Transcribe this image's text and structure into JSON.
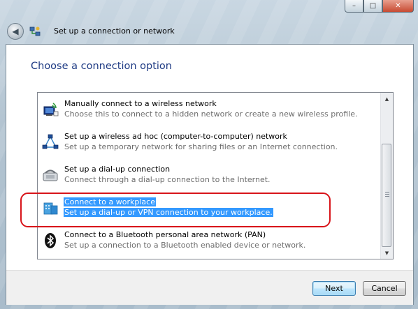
{
  "window": {
    "title": "Set up a connection or network",
    "controls": {
      "minimize": "–",
      "maximize": "□",
      "close": "✕"
    }
  },
  "page": {
    "heading": "Choose a connection option"
  },
  "options": [
    {
      "icon": "wireless-network-icon",
      "title": "Manually connect to a wireless network",
      "description": "Choose this to connect to a hidden network or create a new wireless profile."
    },
    {
      "icon": "adhoc-network-icon",
      "title": "Set up a wireless ad hoc (computer-to-computer) network",
      "description": "Set up a temporary network for sharing files or an Internet connection."
    },
    {
      "icon": "dialup-modem-icon",
      "title": "Set up a dial-up connection",
      "description": "Connect through a dial-up connection to the Internet."
    },
    {
      "icon": "workplace-icon",
      "title": "Connect to a workplace",
      "description": "Set up a dial-up or VPN connection to your workplace.",
      "selected": true
    },
    {
      "icon": "bluetooth-icon",
      "title": "Connect to a Bluetooth personal area network (PAN)",
      "description": "Set up a connection to a Bluetooth enabled device or network."
    }
  ],
  "buttons": {
    "next": "Next",
    "cancel": "Cancel"
  },
  "colors": {
    "heading": "#1f3b84",
    "selection": "#3399ff",
    "annotation": "#d8141a"
  }
}
